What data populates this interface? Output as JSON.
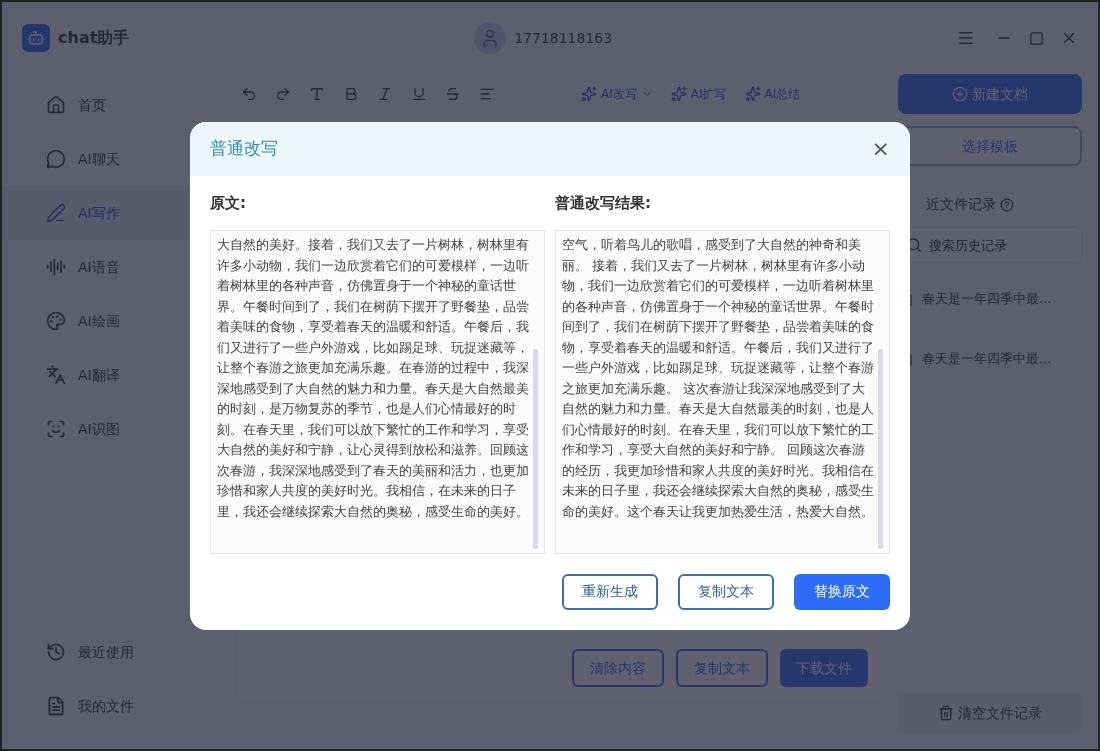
{
  "app": {
    "title": "chat助手",
    "phone": "17718118163"
  },
  "sidebar": {
    "items": [
      {
        "label": "首页",
        "selected": false
      },
      {
        "label": "AI聊天",
        "selected": false
      },
      {
        "label": "AI写作",
        "selected": true
      },
      {
        "label": "AI语音",
        "selected": false
      },
      {
        "label": "AI绘画",
        "selected": false
      },
      {
        "label": "AI翻译",
        "selected": false
      },
      {
        "label": "AI识图",
        "selected": false
      }
    ],
    "bottom_items": [
      {
        "label": "最近使用"
      },
      {
        "label": "我的文件"
      }
    ]
  },
  "editor": {
    "ai_tools": [
      {
        "label": "AI改写",
        "dropdown": true
      },
      {
        "label": "AI扩写",
        "dropdown": false
      },
      {
        "label": "AI总结",
        "dropdown": false
      }
    ],
    "buttons": [
      {
        "label": "清除内容",
        "primary": false
      },
      {
        "label": "复制文本",
        "primary": false
      },
      {
        "label": "下载文件",
        "primary": true
      }
    ]
  },
  "right_panel": {
    "new_button": "新建文档",
    "template_button": "选择模板",
    "records_title": "近文件记录",
    "search_placeholder": "搜索历史记录",
    "files": [
      "春天是一年四季中最...",
      "春天是一年四季中最..."
    ],
    "clear_button": "清空文件记录"
  },
  "dialog": {
    "title": "普通改写",
    "close": "×",
    "original_label": "原文:",
    "result_label": "普通改写结果:",
    "original_text": "大自然的美好。接着，我们又去了一片树林，树林里有许多小动物，我们一边欣赏着它们的可爱模样，一边听着树林里的各种声音，仿佛置身于一个神秘的童话世界。午餐时间到了，我们在树荫下摆开了野餐垫，品尝着美味的食物，享受着春天的温暖和舒适。午餐后，我们又进行了一些户外游戏，比如踢足球、玩捉迷藏等，让整个春游之旅更加充满乐趣。在春游的过程中，我深深地感受到了大自然的魅力和力量。春天是大自然最美的时刻，是万物复苏的季节，也是人们心情最好的时刻。在春天里，我们可以放下繁忙的工作和学习，享受大自然的美好和宁静，让心灵得到放松和滋养。回顾这次春游，我深深地感受到了春天的美丽和活力，也更加珍惜和家人共度的美好时光。我相信，在未来的日子里，我还会继续探索大自然的奥秘，感受生命的美好。",
    "result_text": "空气，听着鸟儿的歌唱，感受到了大自然的神奇和美丽。 接着，我们又去了一片树林，树林里有许多小动物，我们一边欣赏着它们的可爱模样，一边听着树林里的各种声音，仿佛置身于一个神秘的童话世界。午餐时间到了，我们在树荫下摆开了野餐垫，品尝着美味的食物，享受着春天的温暖和舒适。午餐后，我们又进行了一些户外游戏，比如踢足球、玩捉迷藏等，让整个春游之旅更加充满乐趣。 这次春游让我深深地感受到了大自然的魅力和力量。春天是大自然最美的时刻，也是人们心情最好的时刻。在春天里，我们可以放下繁忙的工作和学习，享受大自然的美好和宁静。 回顾这次春游的经历，我更加珍惜和家人共度的美好时光。我相信在未来的日子里，我还会继续探索大自然的奥秘，感受生命的美好。这个春天让我更加热爱生活，热爱大自然。",
    "buttons": [
      {
        "label": "重新生成",
        "primary": false
      },
      {
        "label": "复制文本",
        "primary": false
      },
      {
        "label": "替换原文",
        "primary": true
      }
    ]
  }
}
